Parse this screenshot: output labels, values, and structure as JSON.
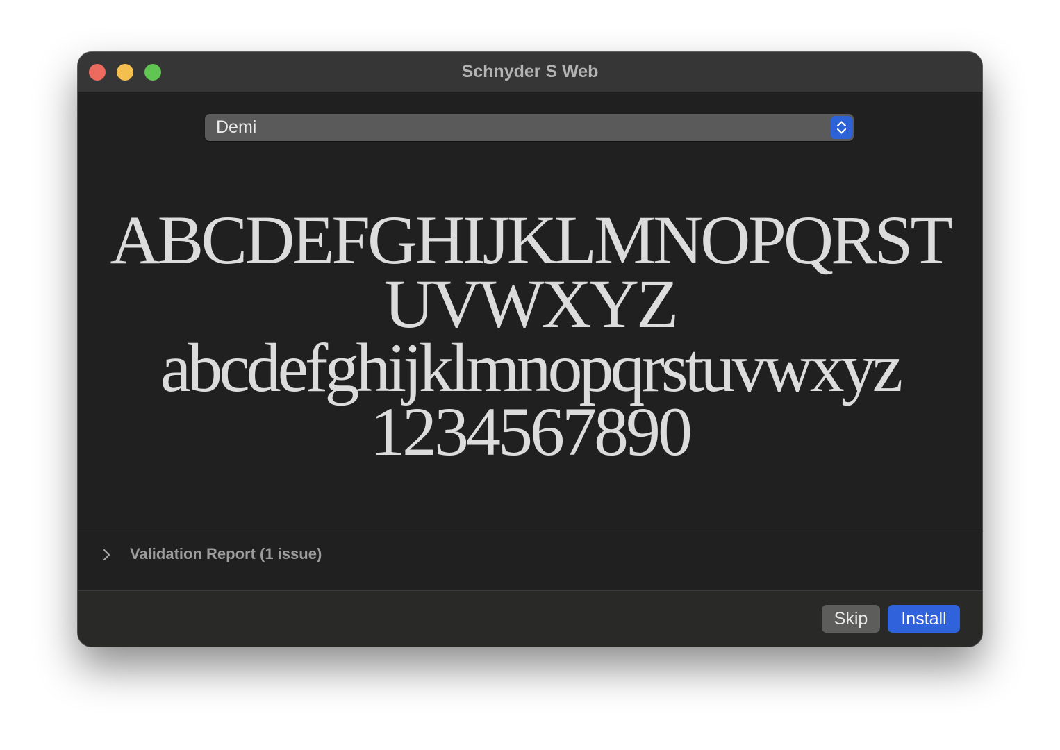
{
  "window": {
    "title": "Schnyder S Web",
    "background": "#202020"
  },
  "font_style_select": {
    "selected": "Demi",
    "accent": "#2e63d7",
    "icon": "chevron-up-down-icon"
  },
  "preview": {
    "uppercase_1": "ABCDEFGHIJKLMNOPQRST",
    "uppercase_2": "UVWXYZ",
    "lowercase": "abcdefghijklmnopqrstuvwxyz",
    "digits": "1234567890"
  },
  "validation": {
    "label": "Validation Report (1 issue)",
    "icon": "chevron-right-icon"
  },
  "footer": {
    "skip_label": "Skip",
    "install_label": "Install",
    "install_color": "#2f62db"
  },
  "traffic_lights": {
    "close": "#ed6a5e",
    "minimize": "#f5bf4f",
    "maximize": "#61c554"
  }
}
